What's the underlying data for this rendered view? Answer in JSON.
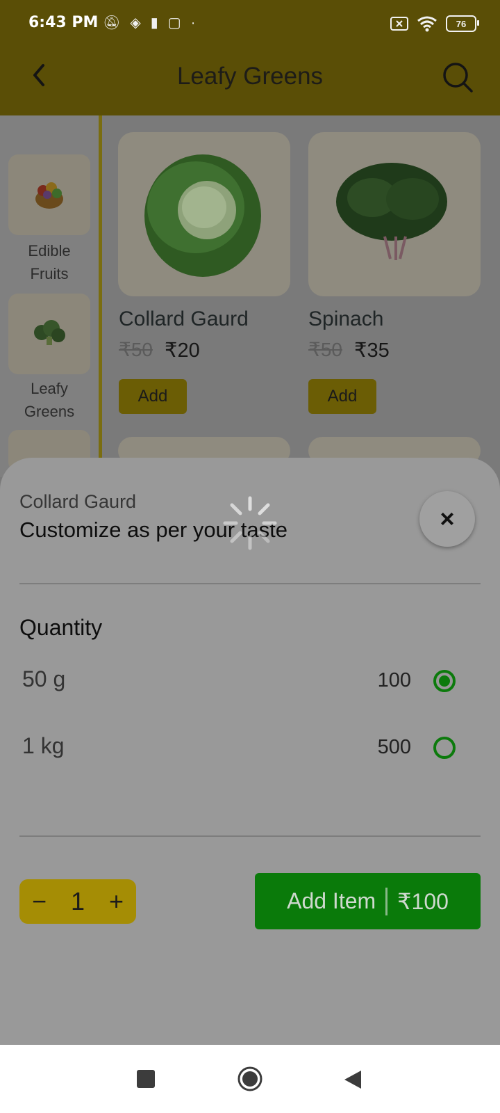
{
  "status_bar": {
    "time": "6:43 PM",
    "battery": "76"
  },
  "header": {
    "title": "Leafy Greens"
  },
  "sidebar": {
    "categories": [
      {
        "label_line1": "Edible",
        "label_line2": "Fruits"
      },
      {
        "label_line1": "Leafy",
        "label_line2": "Greens"
      }
    ]
  },
  "products": [
    {
      "name": "Collard Gaurd",
      "old_price": "₹50",
      "price": "₹20",
      "add_label": "Add"
    },
    {
      "name": "Spinach",
      "old_price": "₹50",
      "price": "₹35",
      "add_label": "Add"
    }
  ],
  "sheet": {
    "subtitle": "Collard Gaurd",
    "title": "Customize as per your taste",
    "close_label": "×",
    "quantity_heading": "Quantity",
    "options": [
      {
        "label": "50 g",
        "price": "100",
        "selected": true
      },
      {
        "label": "1 kg",
        "price": "500",
        "selected": false
      }
    ],
    "stepper": {
      "minus": "−",
      "value": "1",
      "plus": "+"
    },
    "add_button": {
      "label": "Add Item",
      "price": "₹100"
    }
  },
  "colors": {
    "accent_green": "#0a7a0a",
    "accent_yellow": "#a58d05"
  }
}
